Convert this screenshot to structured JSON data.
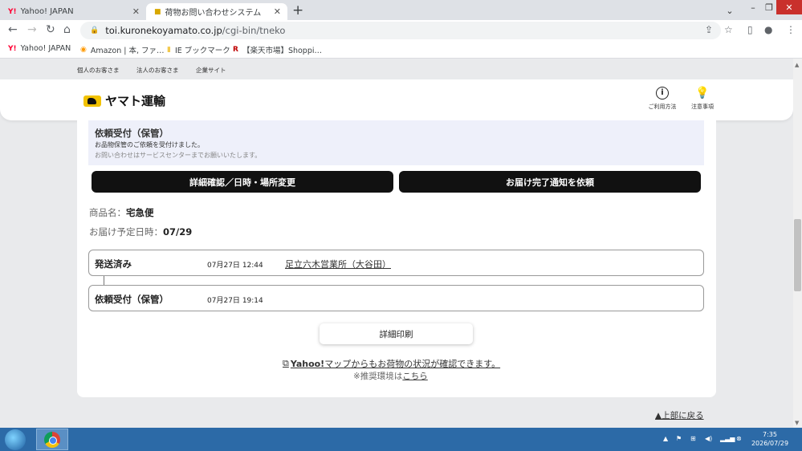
{
  "browser": {
    "tabs": [
      {
        "favicon": "Y!",
        "title": "Yahoo! JAPAN",
        "active": false
      },
      {
        "favicon": "yamato-cat-icon",
        "title": "荷物お問い合わせシステム",
        "active": true
      }
    ],
    "new_tab": "+",
    "url_host": "toi.kuronekoyamato.co.jp",
    "url_path": "/cgi-bin/tneko",
    "bookmarks": [
      {
        "icon": "Y!",
        "label": "Yahoo! JAPAN"
      },
      {
        "icon": "amazon-icon",
        "label": "Amazon | 本, ファ…"
      },
      {
        "icon": "folder-icon",
        "label": "IE ブックマーク"
      },
      {
        "icon": "R",
        "label": "【楽天市場】Shoppi…"
      }
    ]
  },
  "site": {
    "subnav": [
      "個人のお客さま",
      "法人のお客さま",
      "企業サイト"
    ],
    "logo_text": "ヤマト運輸",
    "header_links": [
      {
        "icon": "info-icon",
        "label": "ご利用方法"
      },
      {
        "icon": "lightbulb-icon",
        "label": "注意事項"
      }
    ]
  },
  "notice": {
    "title": "依頼受付（保管）",
    "line1": "お品物保管のご依頼を受付けました。",
    "line2": "お問い合わせはサービスセンターまでお願いいたします。"
  },
  "actions": {
    "change_button": "詳細確認／日時・場所変更",
    "notify_button": "お届け完了通知を依頼"
  },
  "shipment": {
    "product_label": "商品名：",
    "product_value": "宅急便",
    "delivery_label": "お届け予定日時：",
    "delivery_value": "07/29"
  },
  "status_history": [
    {
      "name": "発送済み",
      "date_mm": "07",
      "date_dd": "27",
      "time": "12:44",
      "location": "足立六木営業所（大谷田）"
    },
    {
      "name": "依頼受付（保管）",
      "date_mm": "07",
      "date_dd": "27",
      "time": "19:14",
      "location": ""
    }
  ],
  "labels": {
    "month": "月",
    "day": "日"
  },
  "print_button": "詳細印刷",
  "yahoo_link": {
    "brand": "Yahoo!",
    "text": "マップからもお荷物の状況が確認できます。"
  },
  "recommend": {
    "text": "※推奨環境は",
    "link": "こちら"
  },
  "back_to_top": "▲上部に戻る",
  "taskbar": {
    "time": "7:35",
    "date": "2026/07/29"
  },
  "colors": {
    "accent_black": "#111111",
    "notice_bg": "#eef0fa",
    "close_red": "#c9302c",
    "taskbar_blue": "#2c6aa7"
  }
}
